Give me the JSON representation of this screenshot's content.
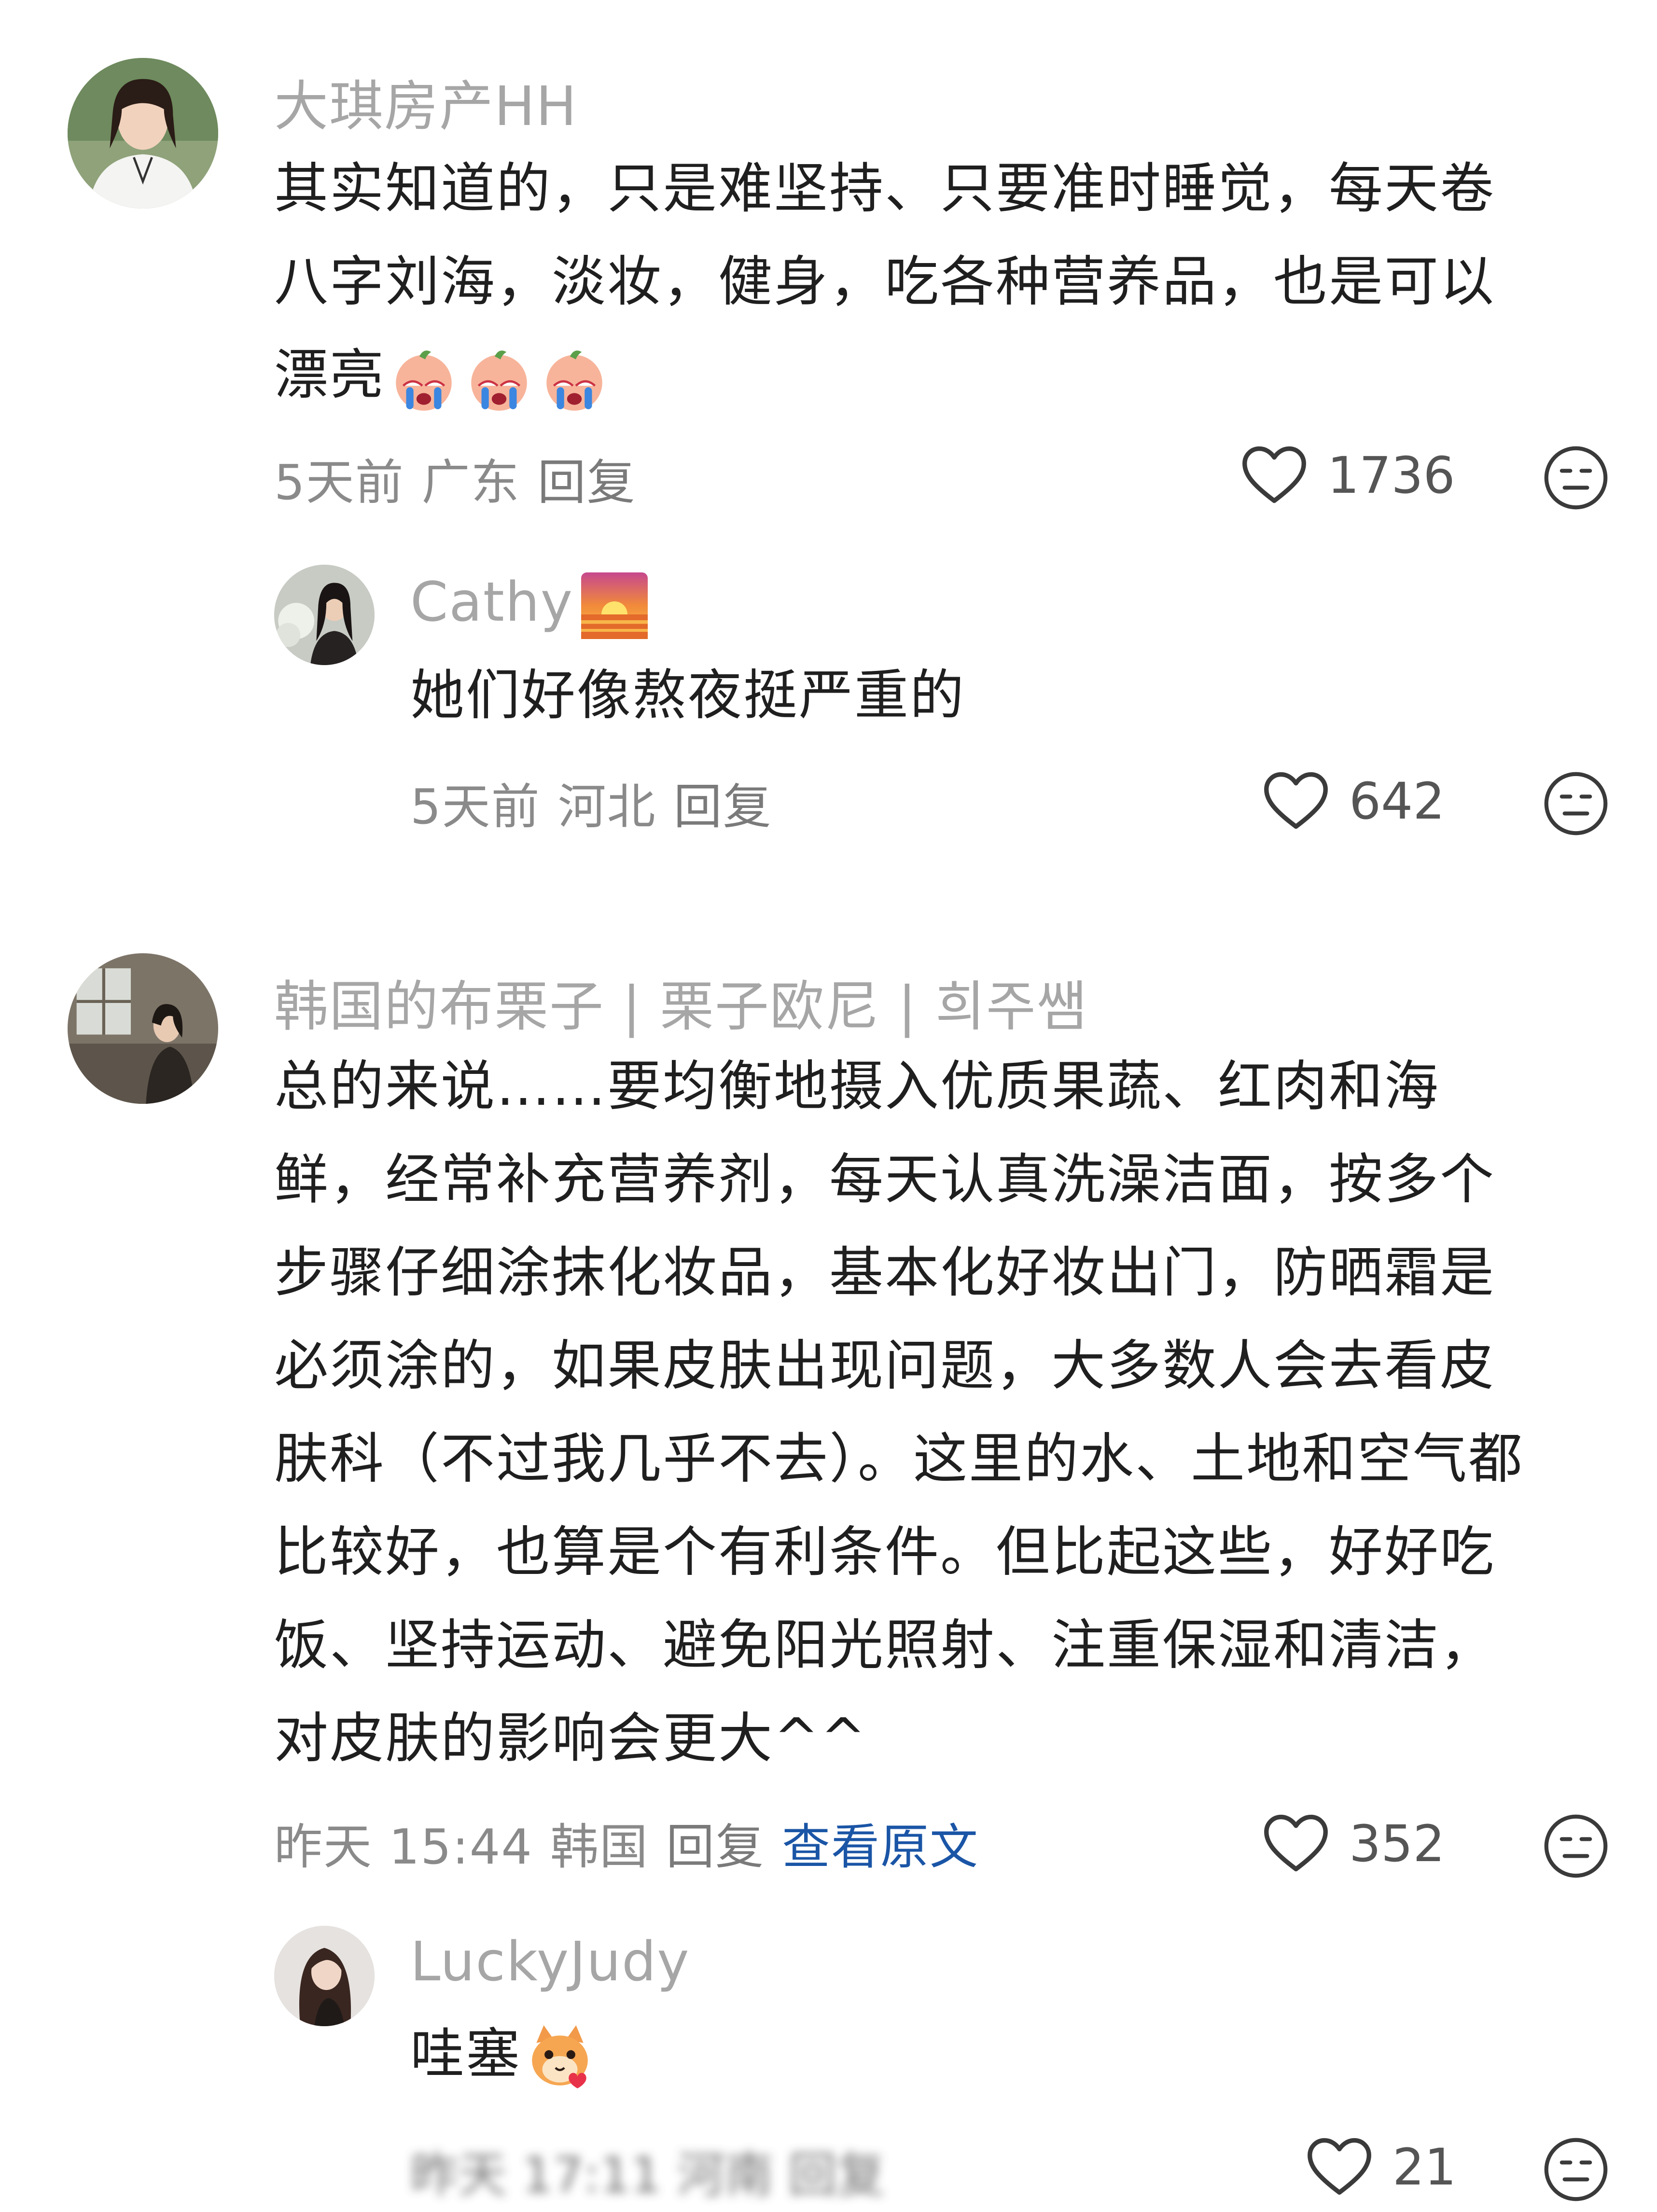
{
  "comments": [
    {
      "username": "大琪房产HH",
      "text_lines": [
        "其实知道的，只是难坚持、只要准时睡觉，每天卷",
        "八字刘海，淡妆，健身，吃各种营养品，也是可以",
        "漂亮"
      ],
      "emojis": [
        "crying-peach-emoji",
        "crying-peach-emoji",
        "crying-peach-emoji"
      ],
      "meta": {
        "time": "5天前",
        "location": "广东",
        "reply": "回复"
      },
      "likes": "1736"
    },
    {
      "username": "Cathy",
      "username_emoji": "sunset-emoji",
      "text": "她们好像熬夜挺严重的",
      "meta": {
        "time": "5天前",
        "location": "河北",
        "reply": "回复"
      },
      "likes": "642"
    },
    {
      "username": "韩国的布栗子 | 栗子欧尼 | 희주쌤",
      "text_lines": [
        "总的来说……要均衡地摄入优质果蔬、红肉和海",
        "鲜，经常补充营养剂，每天认真洗澡洁面，按多个",
        "步骤仔细涂抹化妆品，基本化好妆出门，防晒霜是",
        "必须涂的，如果皮肤出现问题，大多数人会去看皮",
        "肤科（不过我几乎不去）。这里的水、土地和空气都",
        "比较好，也算是个有利条件。但比起这些，好好吃",
        "饭、坚持运动、避免阳光照射、注重保湿和清洁，",
        "对皮肤的影响会更大^^"
      ],
      "meta": {
        "time": "昨天 15:44",
        "location": "韩国",
        "reply": "回复",
        "view_original": "查看原文"
      },
      "likes": "352"
    },
    {
      "username": "LuckyJudy",
      "text": "哇塞",
      "text_emoji": "cat-heart-emoji",
      "meta_blurred": "昨天 17:11 河南 回复",
      "likes": "21"
    }
  ],
  "colors": {
    "username": "#a6a6a6",
    "meta": "#8a8a8a",
    "link": "#1a55a6",
    "text": "#1f1f1f"
  },
  "icons": {
    "like": "heart-outline-icon",
    "dislike": "neutral-face-icon"
  }
}
